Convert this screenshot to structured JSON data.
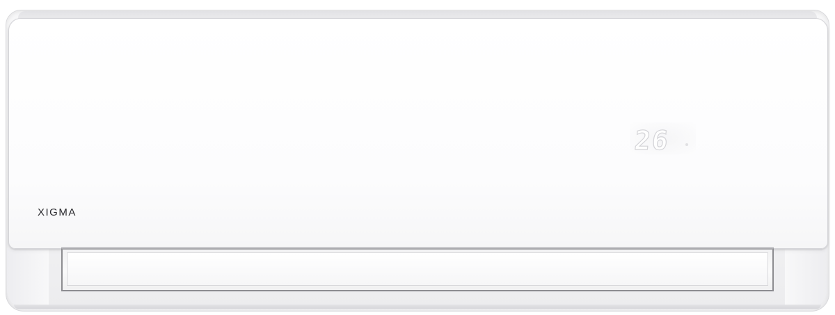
{
  "product": {
    "brand": "XIGMA",
    "display_temperature": "26",
    "body_color": "#f7f7f8",
    "display_color": "#ffffff"
  }
}
